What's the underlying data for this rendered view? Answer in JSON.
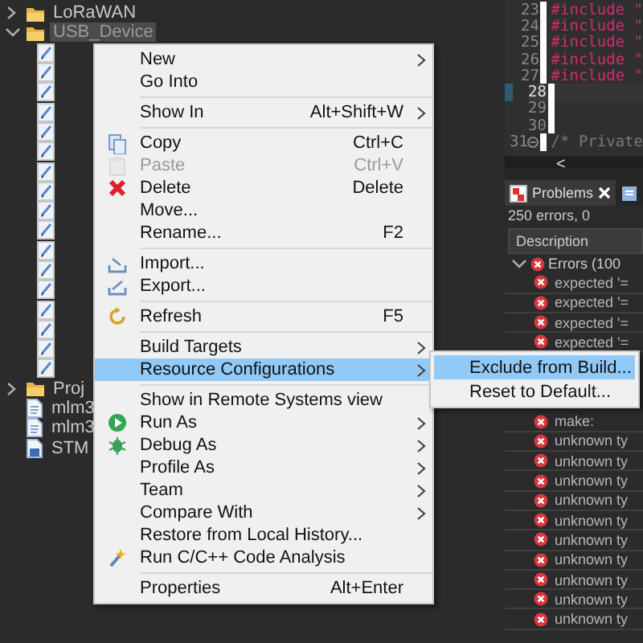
{
  "tree": {
    "items": [
      {
        "kind": "folder",
        "label": "LoRaWAN",
        "expanded": false,
        "selected": false
      },
      {
        "kind": "folder",
        "label": "USB_Device",
        "expanded": true,
        "selected": true,
        "children": [
          {
            "kind": "file"
          },
          {
            "kind": "file"
          },
          {
            "kind": "file"
          },
          {
            "kind": "file"
          },
          {
            "kind": "file"
          },
          {
            "kind": "file"
          },
          {
            "kind": "file"
          },
          {
            "kind": "file"
          },
          {
            "kind": "file"
          },
          {
            "kind": "file"
          },
          {
            "kind": "file"
          },
          {
            "kind": "file"
          },
          {
            "kind": "file"
          },
          {
            "kind": "file"
          },
          {
            "kind": "file"
          },
          {
            "kind": "file"
          },
          {
            "kind": "file"
          }
        ]
      },
      {
        "kind": "folder",
        "label": "Proj",
        "expanded": false,
        "selected": false
      },
      {
        "kind": "file",
        "label": "mlm3",
        "selected": false
      },
      {
        "kind": "file",
        "label": "mlm3",
        "selected": false
      },
      {
        "kind": "linker-file",
        "label": "STM",
        "selected": false
      }
    ]
  },
  "editor": {
    "lines": [
      {
        "number": "23",
        "kind": "directive",
        "code": "#include \"",
        "current": false,
        "fold": false
      },
      {
        "number": "24",
        "kind": "directive",
        "code": "#include \"",
        "current": false,
        "fold": false
      },
      {
        "number": "25",
        "kind": "directive",
        "code": "#include \"",
        "current": false,
        "fold": false
      },
      {
        "number": "26",
        "kind": "directive",
        "code": "#include \"",
        "current": false,
        "fold": false
      },
      {
        "number": "27",
        "kind": "directive",
        "code": "#include \"",
        "current": false,
        "fold": false
      },
      {
        "number": "28",
        "kind": "blank",
        "current": true,
        "fold": false
      },
      {
        "number": "29",
        "kind": "blank",
        "current": false,
        "fold": false
      },
      {
        "number": "30",
        "kind": "blank",
        "current": false,
        "fold": false
      },
      {
        "number": "31",
        "kind": "comment",
        "code": "/* Private",
        "current": false,
        "fold": true
      }
    ],
    "scroll_left": "<"
  },
  "problems": {
    "tabs": [
      {
        "label": "Problems",
        "selected": true,
        "closable": true
      },
      {
        "selected": false,
        "closable": false
      }
    ],
    "summary": "250 errors, 0",
    "columns": [
      "Description"
    ],
    "group": {
      "label": "Errors (100",
      "expanded": true
    },
    "rows": [
      {
        "text": "expected '="
      },
      {
        "text": "expected '="
      },
      {
        "text": "expected '="
      },
      {
        "text": "expected '="
      },
      {
        "text": "make:"
      },
      {
        "text": "unknown ty"
      },
      {
        "text": "unknown ty"
      },
      {
        "text": "unknown ty"
      },
      {
        "text": "unknown ty"
      },
      {
        "text": "unknown ty"
      },
      {
        "text": "unknown ty"
      },
      {
        "text": "unknown ty"
      },
      {
        "text": "unknown ty"
      },
      {
        "text": "unknown ty"
      },
      {
        "text": "unknown ty"
      }
    ]
  },
  "context_menu": {
    "items": [
      {
        "kind": "item",
        "label": "New",
        "submenu": true,
        "disabled": false,
        "selected": false
      },
      {
        "kind": "item",
        "label": "Go Into",
        "submenu": false,
        "disabled": false,
        "selected": false
      },
      {
        "kind": "separator"
      },
      {
        "kind": "item",
        "label": "Show In",
        "shortcut": "Alt+Shift+W",
        "submenu": true,
        "disabled": false,
        "selected": false
      },
      {
        "kind": "separator"
      },
      {
        "kind": "item",
        "label": "Copy",
        "shortcut": "Ctrl+C",
        "submenu": false,
        "disabled": false,
        "selected": false
      },
      {
        "kind": "item",
        "label": "Paste",
        "shortcut": "Ctrl+V",
        "submenu": false,
        "disabled": true,
        "selected": false
      },
      {
        "kind": "item",
        "label": "Delete",
        "shortcut": "Delete",
        "submenu": false,
        "disabled": false,
        "selected": false
      },
      {
        "kind": "item",
        "label": "Move...",
        "submenu": false,
        "disabled": false,
        "selected": false
      },
      {
        "kind": "item",
        "label": "Rename...",
        "shortcut": "F2",
        "submenu": false,
        "disabled": false,
        "selected": false
      },
      {
        "kind": "separator"
      },
      {
        "kind": "item",
        "label": "Import...",
        "submenu": false,
        "disabled": false,
        "selected": false
      },
      {
        "kind": "item",
        "label": "Export...",
        "submenu": false,
        "disabled": false,
        "selected": false
      },
      {
        "kind": "separator"
      },
      {
        "kind": "item",
        "label": "Refresh",
        "shortcut": "F5",
        "submenu": false,
        "disabled": false,
        "selected": false
      },
      {
        "kind": "separator"
      },
      {
        "kind": "item",
        "label": "Build Targets",
        "submenu": true,
        "disabled": false,
        "selected": false
      },
      {
        "kind": "item",
        "label": "Resource Configurations",
        "submenu": true,
        "disabled": false,
        "selected": true
      },
      {
        "kind": "separator"
      },
      {
        "kind": "item",
        "label": "Show in Remote Systems view",
        "submenu": false,
        "disabled": false,
        "selected": false
      },
      {
        "kind": "item",
        "label": "Run As",
        "submenu": true,
        "disabled": false,
        "selected": false
      },
      {
        "kind": "item",
        "label": "Debug As",
        "submenu": true,
        "disabled": false,
        "selected": false
      },
      {
        "kind": "item",
        "label": "Profile As",
        "submenu": true,
        "disabled": false,
        "selected": false
      },
      {
        "kind": "item",
        "label": "Team",
        "submenu": true,
        "disabled": false,
        "selected": false
      },
      {
        "kind": "item",
        "label": "Compare With",
        "submenu": true,
        "disabled": false,
        "selected": false
      },
      {
        "kind": "item",
        "label": "Restore from Local History...",
        "submenu": false,
        "disabled": false,
        "selected": false
      },
      {
        "kind": "item",
        "label": "Run C/C++ Code Analysis",
        "submenu": false,
        "disabled": false,
        "selected": false
      },
      {
        "kind": "separator"
      },
      {
        "kind": "item",
        "label": "Properties",
        "shortcut": "Alt+Enter",
        "submenu": false,
        "disabled": false,
        "selected": false
      }
    ]
  },
  "submenu": {
    "items": [
      {
        "label": "Exclude from Build...",
        "selected": true
      },
      {
        "label": "Reset to Default...",
        "selected": false
      }
    ]
  }
}
